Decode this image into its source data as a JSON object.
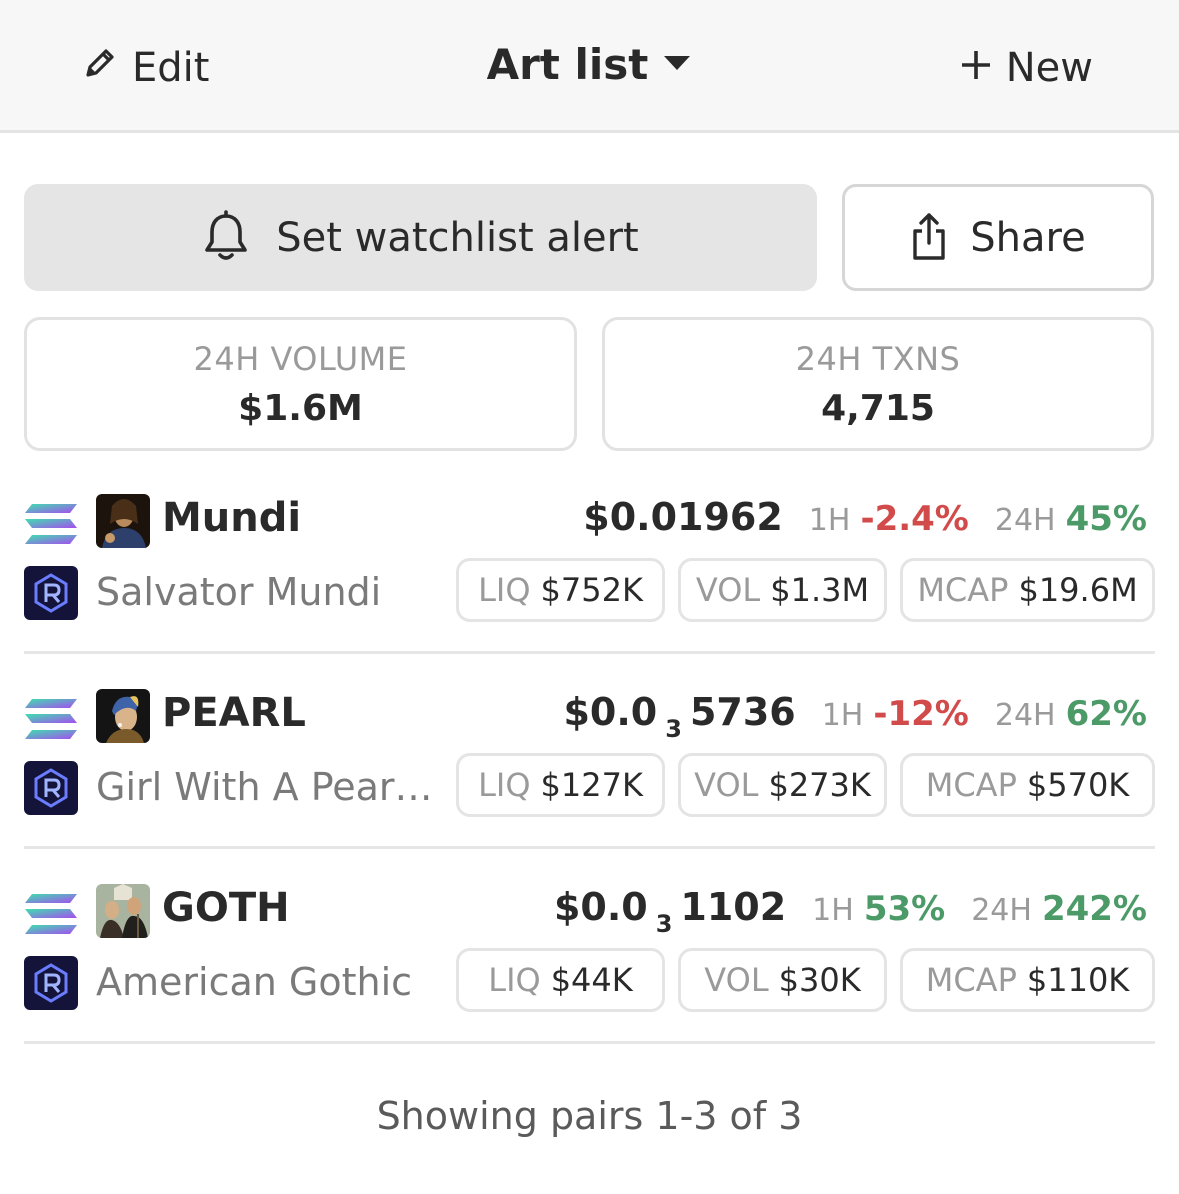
{
  "header": {
    "edit_label": "Edit",
    "title": "Art list",
    "new_label": "New"
  },
  "actions": {
    "alert_label": "Set watchlist alert",
    "share_label": "Share"
  },
  "stats": {
    "volume_label": "24H VOLUME",
    "volume_value": "$1.6M",
    "txns_label": "24H TXNS",
    "txns_value": "4,715"
  },
  "pairs": [
    {
      "symbol": "Mundi",
      "name": "Salvator Mundi",
      "price_main": "$0.01962",
      "price_sub": "",
      "price_tail": "",
      "h1_label": "1H",
      "h1_change": "-2.4%",
      "h24_label": "24H",
      "h24_change": "45%",
      "liq_label": "LIQ",
      "liq": "$752K",
      "vol_label": "VOL",
      "vol": "$1.3M",
      "mcap_label": "MCAP",
      "mcap": "$19.6M"
    },
    {
      "symbol": "PEARL",
      "name": "Girl With A Pearl...",
      "price_main": "$0.0",
      "price_sub": "3",
      "price_tail": "5736",
      "h1_label": "1H",
      "h1_change": "-12%",
      "h24_label": "24H",
      "h24_change": "62%",
      "liq_label": "LIQ",
      "liq": "$127K",
      "vol_label": "VOL",
      "vol": "$273K",
      "mcap_label": "MCAP",
      "mcap": "$570K"
    },
    {
      "symbol": "GOTH",
      "name": "American Gothic",
      "price_main": "$0.0",
      "price_sub": "3",
      "price_tail": "1102",
      "h1_label": "1H",
      "h1_change": "53%",
      "h24_label": "24H",
      "h24_change": "242%",
      "liq_label": "LIQ",
      "liq": "$44K",
      "vol_label": "VOL",
      "vol": "$30K",
      "mcap_label": "MCAP",
      "mcap": "$110K"
    }
  ],
  "footer": {
    "text": "Showing pairs 1-3 of 3"
  },
  "colors": {
    "negative": "#d24b4b",
    "positive": "#4c9a68",
    "dex_bg": "#14143a"
  },
  "icons": [
    "pencil-icon",
    "caret-down-icon",
    "plus-icon",
    "bell-icon",
    "share-icon",
    "solana-icon",
    "raydium-icon"
  ]
}
